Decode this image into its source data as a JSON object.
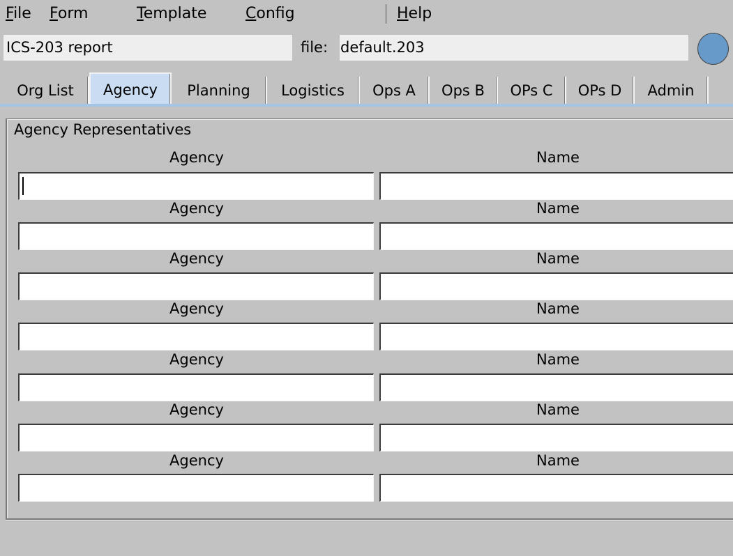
{
  "menu": {
    "items": [
      {
        "mnemonic": "F",
        "rest": "ile"
      },
      {
        "mnemonic": "F",
        "rest": "orm"
      },
      {
        "mnemonic": "T",
        "rest": "emplate"
      },
      {
        "mnemonic": "C",
        "rest": "onfig"
      },
      {
        "mnemonic": "H",
        "rest": "elp"
      }
    ]
  },
  "header": {
    "report_name": "ICS-203 report",
    "file_label": "file:",
    "file_name": "default.203",
    "status_color": "#6799c9"
  },
  "tabs": [
    {
      "label": "Org List",
      "active": false
    },
    {
      "label": "Agency",
      "active": true
    },
    {
      "label": "Planning",
      "active": false
    },
    {
      "label": "Logistics",
      "active": false
    },
    {
      "label": "Ops A",
      "active": false
    },
    {
      "label": "Ops B",
      "active": false
    },
    {
      "label": "OPs C",
      "active": false
    },
    {
      "label": "OPs D",
      "active": false
    },
    {
      "label": "Admin",
      "active": false
    }
  ],
  "panel": {
    "title": "Agency Representatives",
    "rows": [
      {
        "agency_label": "Agency",
        "name_label": "Name",
        "agency_value": "",
        "name_value": ""
      },
      {
        "agency_label": "Agency",
        "name_label": "Name",
        "agency_value": "",
        "name_value": ""
      },
      {
        "agency_label": "Agency",
        "name_label": "Name",
        "agency_value": "",
        "name_value": ""
      },
      {
        "agency_label": "Agency",
        "name_label": "Name",
        "agency_value": "",
        "name_value": ""
      },
      {
        "agency_label": "Agency",
        "name_label": "Name",
        "agency_value": "",
        "name_value": ""
      },
      {
        "agency_label": "Agency",
        "name_label": "Name",
        "agency_value": "",
        "name_value": ""
      },
      {
        "agency_label": "Agency",
        "name_label": "Name",
        "agency_value": "",
        "name_value": ""
      }
    ]
  },
  "colors": {
    "window_bg": "#c2c2c2",
    "active_tab_bg": "#c9dcf1",
    "tab_underline": "#a5c4e6"
  }
}
